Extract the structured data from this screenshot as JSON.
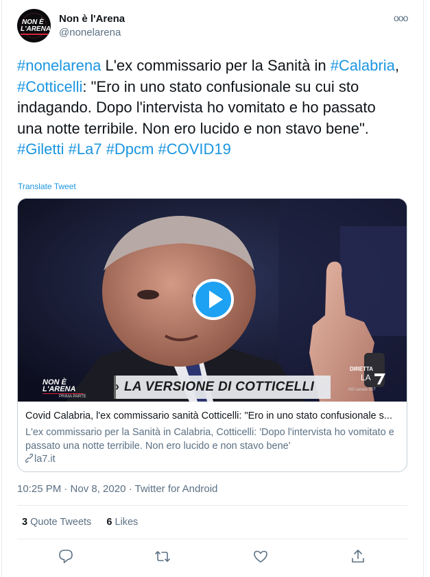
{
  "tweet": {
    "author_name": "Non è l'Arena",
    "author_handle": "@nonelarena",
    "more_label": "ooo",
    "text_parts": {
      "t1": "#nonelarena",
      "t2": " L'ex commissario per la Sanità in ",
      "t3": "#Calabria",
      "t4": ", ",
      "t5": "#Cotticelli",
      "t6": ": \"Ero in uno stato confusionale su cui sto indagando. Dopo l'intervista ho vomitato e ho passato una notte terribile. Non ero lucido e non stavo bene\".",
      "h1": "#Giletti",
      "h2": "#La7",
      "h3": "#Dpcm",
      "h4": "#COVID19"
    },
    "translate_label": "Translate Tweet",
    "timestamp": "10:25 PM · Nov 8, 2020 · Twitter for Android"
  },
  "avatar": {
    "line1": "NON È",
    "line2": "L'ARENA"
  },
  "video": {
    "caption": "LA VERSIONE DI COTTICELLI",
    "caption_chevron": "›",
    "brand_line1": "NON È",
    "brand_line2": "L'ARENA",
    "brand_sub": "PRIMA PARTE",
    "channel_top": "DIRETTA",
    "channel_name": "LA",
    "channel_hd": "HD canale 507"
  },
  "card": {
    "title": "Covid Calabria, l'ex commissario sanità Cotticelli: \"Ero in uno stato confusionale s...",
    "description": "L'ex commissario per la Sanità in Calabria, Cotticelli: 'Dopo l'intervista ho vomitato e passato una notte terribile. Non ero lucido e non stavo bene'",
    "domain": "la7.it"
  },
  "stats": {
    "quote_count": "3",
    "quote_label": "Quote Tweets",
    "like_count": "6",
    "like_label": "Likes"
  },
  "icons": [
    "more-icon",
    "play-icon",
    "link-icon",
    "reply-icon",
    "retweet-icon",
    "like-icon",
    "share-icon"
  ],
  "colors": {
    "link": "#1b95e0",
    "play_button": "#1da1f2",
    "secondary_text": "#5b7083",
    "brand_red": "#d9243b"
  }
}
